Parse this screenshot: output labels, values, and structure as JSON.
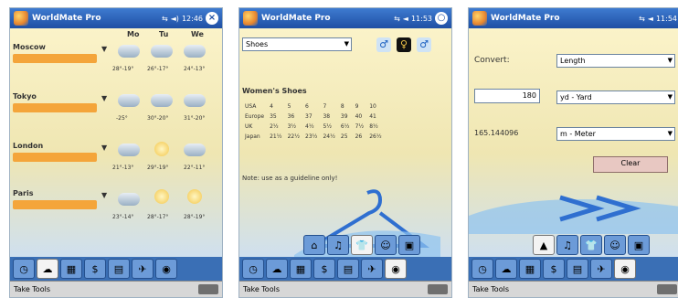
{
  "app_title": "WorldMate Pro",
  "bottom_menu_label": "Take Tools",
  "screens": [
    {
      "time": "12:46",
      "days": [
        "Mo",
        "Tu",
        "We"
      ],
      "cities": [
        {
          "name": "Moscow",
          "temps": [
            "28°-19°",
            "26°-17°",
            "24°-13°"
          ],
          "weather": [
            "cloud",
            "cloud",
            "cloud"
          ]
        },
        {
          "name": "Tokyo",
          "temps": [
            "-25°",
            "30°-20°",
            "31°-20°"
          ],
          "weather": [
            "cloud",
            "cloud",
            "cloud"
          ]
        },
        {
          "name": "London",
          "temps": [
            "21°-13°",
            "29°-19°",
            "22°-11°"
          ],
          "weather": [
            "cloud",
            "sun",
            "cloud"
          ]
        },
        {
          "name": "Paris",
          "temps": [
            "23°-14°",
            "28°-17°",
            "28°-19°"
          ],
          "weather": [
            "cloud",
            "sun",
            "sun"
          ]
        }
      ]
    },
    {
      "time": "11:53",
      "category": "Shoes",
      "section_title": "Women's Shoes",
      "rows": [
        [
          "USA",
          "4",
          "5",
          "6",
          "7",
          "8",
          "9",
          "10"
        ],
        [
          "Europe",
          "35",
          "36",
          "37",
          "38",
          "39",
          "40",
          "41"
        ],
        [
          "UK",
          "2½",
          "3½",
          "4½",
          "5½",
          "6½",
          "7½",
          "8½"
        ],
        [
          "Japan",
          "21½",
          "22½",
          "23½",
          "24½",
          "25",
          "26",
          "26½"
        ]
      ],
      "note": "Note: use as a guideline only!"
    },
    {
      "time": "11:54",
      "convert_label": "Convert:",
      "category": "Length",
      "input_value": "180",
      "from_unit": "yd - Yard",
      "result_value": "165.144096",
      "to_unit": "m - Meter",
      "clear_label": "Clear"
    }
  ],
  "colors": {
    "titlebar": "#1f4fa4",
    "city_bar": "#f4a53a",
    "tabbar": "#3a6fb5"
  }
}
